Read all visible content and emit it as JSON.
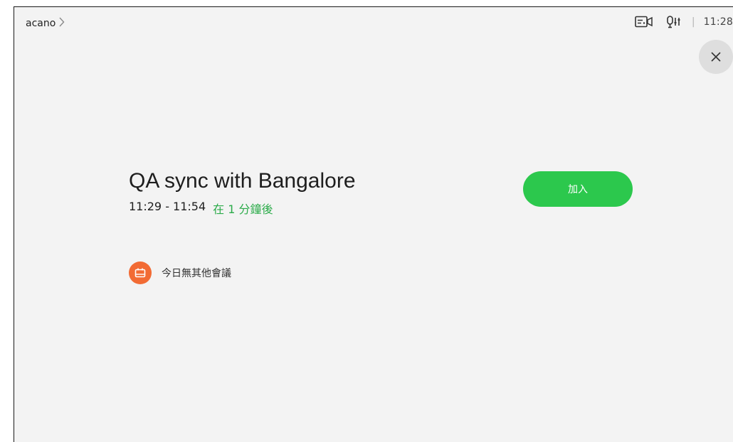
{
  "header": {
    "device_name": "acano",
    "clock": "11:28",
    "separator": "|",
    "icons": [
      "video-layout-icon",
      "audio-settings-icon",
      "chevron-right-icon",
      "close-icon"
    ]
  },
  "meeting": {
    "title": "QA sync with Bangalore",
    "time_range": "11:29 - 11:54",
    "starts_in": "在 1 分鐘後",
    "join_label": "加入"
  },
  "agenda": {
    "empty_message": "今日無其他會議",
    "icon": "calendar-icon"
  },
  "colors": {
    "accent_green": "#2cc84d",
    "soon_text": "#2cab4a",
    "calendar_badge": "#f26b34",
    "background": "#f3f3f3"
  }
}
